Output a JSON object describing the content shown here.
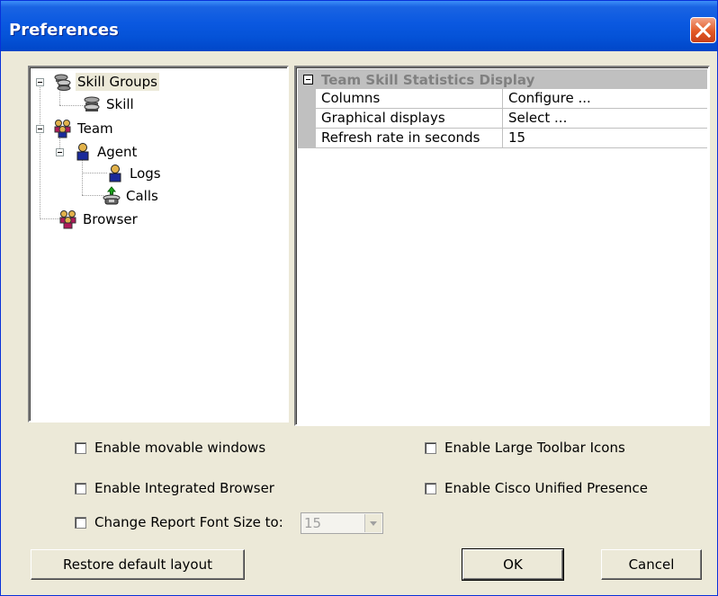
{
  "window": {
    "title": "Preferences"
  },
  "tree": {
    "items": [
      {
        "label": "Skill Groups",
        "icon": "skill-groups-icon",
        "expanded": true,
        "selected": true
      },
      {
        "label": "Skill",
        "icon": "skill-icon"
      },
      {
        "label": "Team",
        "icon": "team-icon",
        "expanded": true
      },
      {
        "label": "Agent",
        "icon": "agent-icon",
        "expanded": true
      },
      {
        "label": "Logs",
        "icon": "logs-icon"
      },
      {
        "label": "Calls",
        "icon": "calls-icon"
      },
      {
        "label": "Browser",
        "icon": "browser-icon"
      }
    ]
  },
  "properties": {
    "header": "Team Skill Statistics Display",
    "rows": [
      {
        "name": "Columns",
        "value": "Configure ..."
      },
      {
        "name": "Graphical displays",
        "value": "Select ..."
      },
      {
        "name": "Refresh rate in seconds",
        "value": "15"
      }
    ]
  },
  "options": {
    "movable_windows": "Enable movable windows",
    "large_toolbar_icons": "Enable Large Toolbar Icons",
    "integrated_browser": "Enable Integrated Browser",
    "cisco_unified_presence": "Enable Cisco Unified Presence",
    "change_font_size": "Change Report Font Size to:",
    "font_size_value": "15"
  },
  "buttons": {
    "restore": "Restore default layout",
    "ok": "OK",
    "cancel": "Cancel"
  },
  "colors": {
    "titlebar": "#0553d8",
    "dialog_bg": "#ece9d8",
    "close": "#e35a26"
  }
}
